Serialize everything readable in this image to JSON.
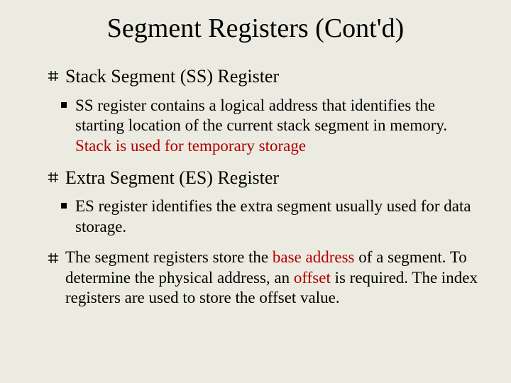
{
  "title": "Segment Registers (Cont'd)",
  "items": [
    {
      "heading": "Stack Segment (SS) Register",
      "sub": {
        "pre": "SS register contains a logical address that identifies the starting location of the current stack segment in memory. ",
        "hl": "Stack is used for temporary storage",
        "post": ""
      }
    },
    {
      "heading": "Extra Segment (ES) Register",
      "sub": {
        "pre": "ES register identifies the extra segment usually used for data storage.",
        "hl": "",
        "post": ""
      }
    }
  ],
  "para": {
    "p1": "The segment registers store the ",
    "h1": "base address",
    "p2": " of a segment. To determine the physical address, an ",
    "h2": "offset",
    "p3": " is required. The index registers are used to store the offset value."
  }
}
